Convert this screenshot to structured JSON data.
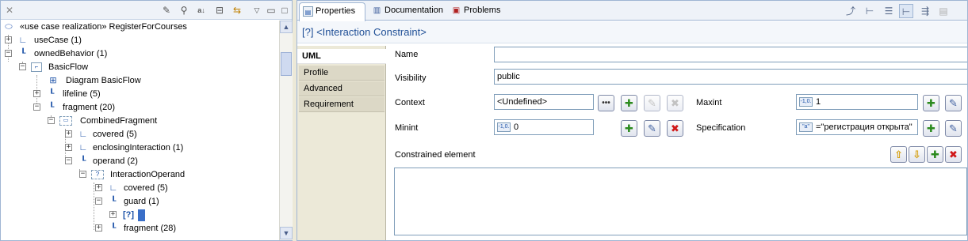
{
  "tree": {
    "rows": [
      {
        "label": "«use case realization» RegisterForCourses",
        "icon": "use-case-realization-icon"
      },
      {
        "label": "useCase (1)",
        "icon": "reference-icon"
      },
      {
        "label": "ownedBehavior (1)",
        "icon": "association-icon"
      },
      {
        "label": "BasicFlow",
        "icon": "interaction-icon"
      },
      {
        "label": "Diagram BasicFlow",
        "icon": "diagram-icon"
      },
      {
        "label": "lifeline (5)",
        "icon": "association-icon"
      },
      {
        "label": "fragment (20)",
        "icon": "association-icon"
      },
      {
        "label": "CombinedFragment",
        "icon": "combined-fragment-icon"
      },
      {
        "label": "covered (5)",
        "icon": "reference-icon"
      },
      {
        "label": "enclosingInteraction (1)",
        "icon": "reference-icon"
      },
      {
        "label": "operand (2)",
        "icon": "association-icon"
      },
      {
        "label": "InteractionOperand",
        "icon": "operand-icon"
      },
      {
        "label": "covered (5)",
        "icon": "reference-icon"
      },
      {
        "label": "guard (1)",
        "icon": "association-icon"
      },
      {
        "label": "[?]",
        "icon": "constraint-icon"
      },
      {
        "label": "fragment (28)",
        "icon": "association-icon"
      }
    ]
  },
  "tabs": [
    {
      "label": "Properties",
      "icon": "properties-icon"
    },
    {
      "label": "Documentation",
      "icon": "documentation-icon"
    },
    {
      "label": "Problems",
      "icon": "problems-icon"
    }
  ],
  "title": "[?] <Interaction Constraint>",
  "sidetabs": [
    "UML",
    "Profile",
    "Advanced",
    "Requirement"
  ],
  "form": {
    "name_label": "Name",
    "name_value": "",
    "visibility_label": "Visibility",
    "visibility_value": "public",
    "context_label": "Context",
    "context_value": "<Undefined>",
    "maxint_label": "Maxint",
    "maxint_value": "1",
    "maxint_badge": "-1,0.",
    "minint_label": "Minint",
    "minint_value": "0",
    "minint_badge": "-1,0.",
    "specification_label": "Specification",
    "specification_value": "=\"регистрация открыта\"",
    "specification_badge": "\"a\"",
    "constrained_label": "Constrained element"
  },
  "colors": {
    "accent": "#1f4f96",
    "selection": "#3a6fc8",
    "add": "#2b8a1e",
    "delete": "#d01818"
  }
}
